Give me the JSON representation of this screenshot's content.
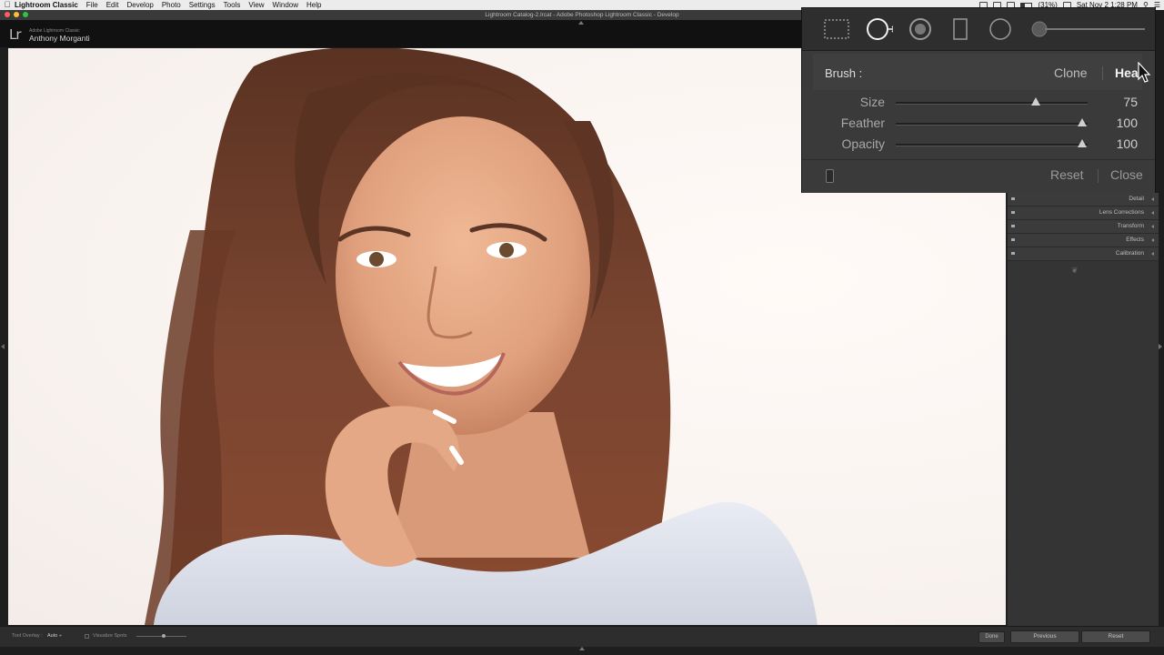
{
  "menubar": {
    "app": "Lightroom Classic",
    "items": [
      "File",
      "Edit",
      "Develop",
      "Photo",
      "Settings",
      "Tools",
      "View",
      "Window",
      "Help"
    ],
    "battery": "(31%)",
    "clock": "Sat Nov 2  1:28 PM"
  },
  "window": {
    "title": "Lightroom Catalog-2.lrcat - Adobe Photoshop Lightroom Classic - Develop"
  },
  "identity": {
    "logo": "Lr",
    "line1": "Adobe Lightroom Classic",
    "name": "Anthony Morganti"
  },
  "spot_removal": {
    "brush_label": "Brush :",
    "mode_clone": "Clone",
    "mode_heal": "Heal",
    "sliders": [
      {
        "name": "Size",
        "value": "75",
        "fraction": 0.73
      },
      {
        "name": "Feather",
        "value": "100",
        "fraction": 0.97
      },
      {
        "name": "Opacity",
        "value": "100",
        "fraction": 0.97
      }
    ],
    "reset": "Reset",
    "close": "Close"
  },
  "right_panel": {
    "sections": [
      "Detail",
      "Lens Corrections",
      "Transform",
      "Effects",
      "Calibration"
    ]
  },
  "toolbar": {
    "tool_overlay_label": "Tool Overlay :",
    "tool_overlay_value": "Auto ÷",
    "visualize_spots": "Visualize Spots",
    "done": "Done",
    "previous": "Previous",
    "reset": "Reset"
  },
  "colors": {
    "mac_red": "#ff5f57",
    "mac_yellow": "#febc2e",
    "mac_green": "#28c840"
  }
}
